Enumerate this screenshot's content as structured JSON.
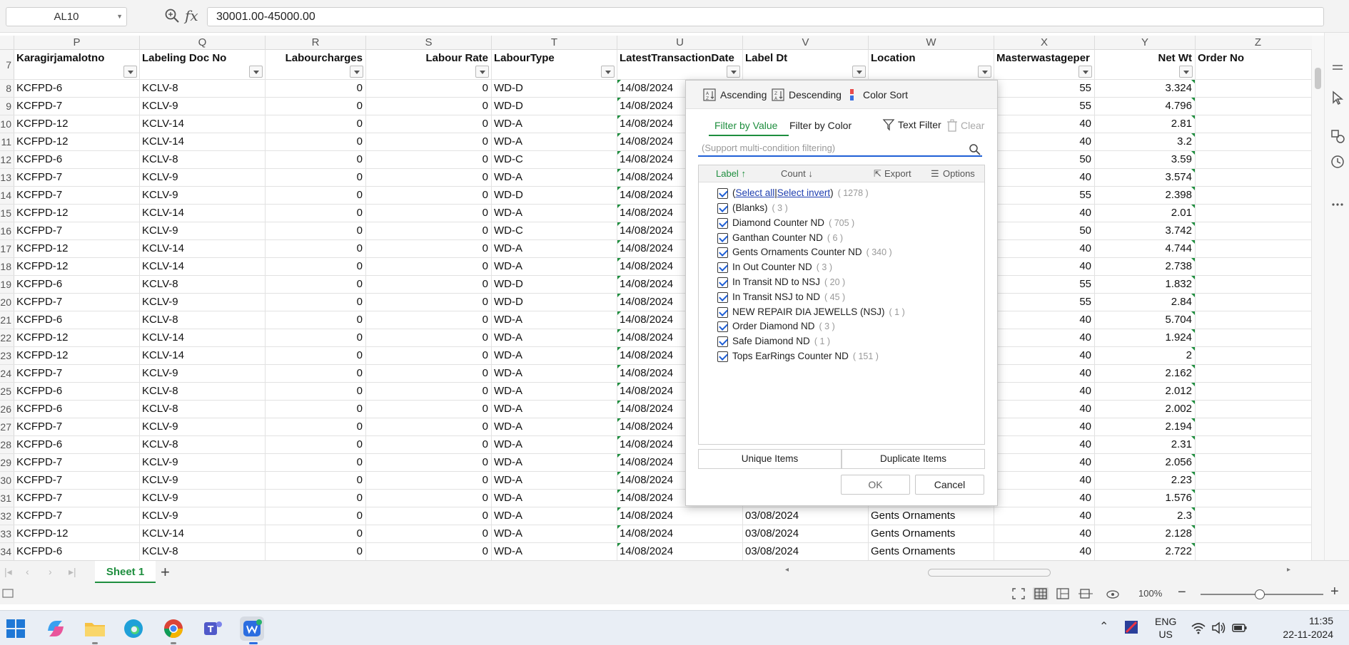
{
  "formula_bar": {
    "cell_ref": "AL10",
    "fx": "fx",
    "formula_value": "30001.00-45000.00"
  },
  "columns": [
    {
      "letter": "P",
      "header": "Karagirjamalotno"
    },
    {
      "letter": "Q",
      "header": "Labeling Doc No"
    },
    {
      "letter": "R",
      "header": "Labourcharges"
    },
    {
      "letter": "S",
      "header": "Labour Rate"
    },
    {
      "letter": "T",
      "header": "LabourType"
    },
    {
      "letter": "U",
      "header": "LatestTransactionDate"
    },
    {
      "letter": "V",
      "header": "Label Dt"
    },
    {
      "letter": "W",
      "header": "Location"
    },
    {
      "letter": "X",
      "header": "Masterwastageper"
    },
    {
      "letter": "Y",
      "header": "Net Wt"
    },
    {
      "letter": "Z",
      "header": "Order No"
    }
  ],
  "header_row_number": "7",
  "rows": [
    {
      "n": "8",
      "p": "KCFPD-6",
      "q": "KCLV-8",
      "r": "0",
      "s": "0",
      "t": "WD-D",
      "u": "14/08/2024",
      "v": "",
      "w": "",
      "x": "55",
      "y": "3.324"
    },
    {
      "n": "9",
      "p": "KCFPD-7",
      "q": "KCLV-9",
      "r": "0",
      "s": "0",
      "t": "WD-D",
      "u": "14/08/2024",
      "v": "",
      "w": "",
      "x": "55",
      "y": "4.796"
    },
    {
      "n": "10",
      "p": "KCFPD-12",
      "q": "KCLV-14",
      "r": "0",
      "s": "0",
      "t": "WD-A",
      "u": "14/08/2024",
      "v": "",
      "w": "",
      "x": "40",
      "y": "2.81"
    },
    {
      "n": "11",
      "p": "KCFPD-12",
      "q": "KCLV-14",
      "r": "0",
      "s": "0",
      "t": "WD-A",
      "u": "14/08/2024",
      "v": "",
      "w": "",
      "x": "40",
      "y": "3.2"
    },
    {
      "n": "12",
      "p": "KCFPD-6",
      "q": "KCLV-8",
      "r": "0",
      "s": "0",
      "t": "WD-C",
      "u": "14/08/2024",
      "v": "",
      "w": "",
      "x": "50",
      "y": "3.59"
    },
    {
      "n": "13",
      "p": "KCFPD-7",
      "q": "KCLV-9",
      "r": "0",
      "s": "0",
      "t": "WD-A",
      "u": "14/08/2024",
      "v": "",
      "w": "",
      "x": "40",
      "y": "3.574"
    },
    {
      "n": "14",
      "p": "KCFPD-7",
      "q": "KCLV-9",
      "r": "0",
      "s": "0",
      "t": "WD-D",
      "u": "14/08/2024",
      "v": "",
      "w": "",
      "x": "55",
      "y": "2.398"
    },
    {
      "n": "15",
      "p": "KCFPD-12",
      "q": "KCLV-14",
      "r": "0",
      "s": "0",
      "t": "WD-A",
      "u": "14/08/2024",
      "v": "",
      "w": "",
      "x": "40",
      "y": "2.01"
    },
    {
      "n": "16",
      "p": "KCFPD-7",
      "q": "KCLV-9",
      "r": "0",
      "s": "0",
      "t": "WD-C",
      "u": "14/08/2024",
      "v": "",
      "w": "",
      "x": "50",
      "y": "3.742"
    },
    {
      "n": "17",
      "p": "KCFPD-12",
      "q": "KCLV-14",
      "r": "0",
      "s": "0",
      "t": "WD-A",
      "u": "14/08/2024",
      "v": "",
      "w": "",
      "x": "40",
      "y": "4.744"
    },
    {
      "n": "18",
      "p": "KCFPD-12",
      "q": "KCLV-14",
      "r": "0",
      "s": "0",
      "t": "WD-A",
      "u": "14/08/2024",
      "v": "",
      "w": "",
      "x": "40",
      "y": "2.738"
    },
    {
      "n": "19",
      "p": "KCFPD-6",
      "q": "KCLV-8",
      "r": "0",
      "s": "0",
      "t": "WD-D",
      "u": "14/08/2024",
      "v": "",
      "w": "",
      "x": "55",
      "y": "1.832"
    },
    {
      "n": "20",
      "p": "KCFPD-7",
      "q": "KCLV-9",
      "r": "0",
      "s": "0",
      "t": "WD-D",
      "u": "14/08/2024",
      "v": "",
      "w": "",
      "x": "55",
      "y": "2.84"
    },
    {
      "n": "21",
      "p": "KCFPD-6",
      "q": "KCLV-8",
      "r": "0",
      "s": "0",
      "t": "WD-A",
      "u": "14/08/2024",
      "v": "",
      "w": "",
      "x": "40",
      "y": "5.704"
    },
    {
      "n": "22",
      "p": "KCFPD-12",
      "q": "KCLV-14",
      "r": "0",
      "s": "0",
      "t": "WD-A",
      "u": "14/08/2024",
      "v": "",
      "w": "",
      "x": "40",
      "y": "1.924"
    },
    {
      "n": "23",
      "p": "KCFPD-12",
      "q": "KCLV-14",
      "r": "0",
      "s": "0",
      "t": "WD-A",
      "u": "14/08/2024",
      "v": "",
      "w": "",
      "x": "40",
      "y": "2"
    },
    {
      "n": "24",
      "p": "KCFPD-7",
      "q": "KCLV-9",
      "r": "0",
      "s": "0",
      "t": "WD-A",
      "u": "14/08/2024",
      "v": "",
      "w": "",
      "x": "40",
      "y": "2.162"
    },
    {
      "n": "25",
      "p": "KCFPD-6",
      "q": "KCLV-8",
      "r": "0",
      "s": "0",
      "t": "WD-A",
      "u": "14/08/2024",
      "v": "",
      "w": "",
      "x": "40",
      "y": "2.012"
    },
    {
      "n": "26",
      "p": "KCFPD-6",
      "q": "KCLV-8",
      "r": "0",
      "s": "0",
      "t": "WD-A",
      "u": "14/08/2024",
      "v": "",
      "w": "",
      "x": "40",
      "y": "2.002"
    },
    {
      "n": "27",
      "p": "KCFPD-7",
      "q": "KCLV-9",
      "r": "0",
      "s": "0",
      "t": "WD-A",
      "u": "14/08/2024",
      "v": "",
      "w": "",
      "x": "40",
      "y": "2.194"
    },
    {
      "n": "28",
      "p": "KCFPD-6",
      "q": "KCLV-8",
      "r": "0",
      "s": "0",
      "t": "WD-A",
      "u": "14/08/2024",
      "v": "",
      "w": "",
      "x": "40",
      "y": "2.31"
    },
    {
      "n": "29",
      "p": "KCFPD-7",
      "q": "KCLV-9",
      "r": "0",
      "s": "0",
      "t": "WD-A",
      "u": "14/08/2024",
      "v": "",
      "w": "",
      "x": "40",
      "y": "2.056"
    },
    {
      "n": "30",
      "p": "KCFPD-7",
      "q": "KCLV-9",
      "r": "0",
      "s": "0",
      "t": "WD-A",
      "u": "14/08/2024",
      "v": "",
      "w": "",
      "x": "40",
      "y": "2.23"
    },
    {
      "n": "31",
      "p": "KCFPD-7",
      "q": "KCLV-9",
      "r": "0",
      "s": "0",
      "t": "WD-A",
      "u": "14/08/2024",
      "v": "",
      "w": "",
      "x": "40",
      "y": "1.576"
    },
    {
      "n": "32",
      "p": "KCFPD-7",
      "q": "KCLV-9",
      "r": "0",
      "s": "0",
      "t": "WD-A",
      "u": "14/08/2024",
      "v": "03/08/2024",
      "w": "Gents Ornaments",
      "x": "40",
      "y": "2.3"
    },
    {
      "n": "33",
      "p": "KCFPD-12",
      "q": "KCLV-14",
      "r": "0",
      "s": "0",
      "t": "WD-A",
      "u": "14/08/2024",
      "v": "03/08/2024",
      "w": "Gents Ornaments",
      "x": "40",
      "y": "2.128"
    },
    {
      "n": "34",
      "p": "KCFPD-6",
      "q": "KCLV-8",
      "r": "0",
      "s": "0",
      "t": "WD-A",
      "u": "14/08/2024",
      "v": "03/08/2024",
      "w": "Gents Ornaments",
      "x": "40",
      "y": "2.722"
    }
  ],
  "filter": {
    "ascending": "Ascending",
    "descending": "Descending",
    "color_sort": "Color Sort",
    "tab_value": "Filter by Value",
    "tab_color": "Filter by Color",
    "text_filter": "Text Filter",
    "clear": "Clear",
    "search_placeholder": "(Support multi-condition filtering)",
    "col_label": "Label",
    "col_count": "Count",
    "export": "Export",
    "options": "Options",
    "select_open": "(",
    "select_all": "Select all",
    "select_sep": "|",
    "select_invert": "Select invert",
    "select_close": ")",
    "select_count": "( 1278 )",
    "items": [
      {
        "label": "(Blanks)",
        "count": "( 3 )"
      },
      {
        "label": "Diamond Counter ND",
        "count": "( 705 )"
      },
      {
        "label": "Ganthan Counter ND",
        "count": "( 6 )"
      },
      {
        "label": "Gents Ornaments Counter ND",
        "count": "( 340 )"
      },
      {
        "label": "In Out Counter ND",
        "count": "( 3 )"
      },
      {
        "label": "In Transit ND to NSJ",
        "count": "( 20 )"
      },
      {
        "label": "In Transit NSJ to ND",
        "count": "( 45 )"
      },
      {
        "label": "NEW REPAIR DIA JEWELLS (NSJ)",
        "count": "( 1 )"
      },
      {
        "label": "Order Diamond ND",
        "count": "( 3 )"
      },
      {
        "label": "Safe Diamond ND",
        "count": "( 1 )"
      },
      {
        "label": "Tops EarRings Counter ND",
        "count": "( 151 )"
      }
    ],
    "unique_items": "Unique Items",
    "duplicate_items": "Duplicate Items",
    "ok": "OK",
    "cancel": "Cancel"
  },
  "sheet_tabs": {
    "active": "Sheet 1",
    "add": "+"
  },
  "status": {
    "zoom": "100%",
    "minus": "−",
    "plus": "+"
  },
  "taskbar": {
    "lang_1": "ENG",
    "lang_2": "US",
    "time": "11:35",
    "date": "22-11-2024"
  },
  "colors": {
    "accent_green": "#1e8e3e",
    "link_blue": "#1f3fb0",
    "search_underline": "#1f5fd6"
  }
}
